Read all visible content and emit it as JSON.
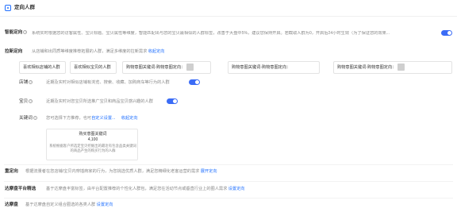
{
  "header": {
    "title": "定向人群"
  },
  "smart": {
    "label": "智能定向",
    "desc": "系统实时根据您的访客属性、宝贝标题、宝贝属性等维度，智能匹配出与您的宝贝最相似的人群标签，改善于大盘中5%，建议您保持开启。若截取人群为0，开启后24小时生效（为了保证您的效果...",
    "toggle_on": true
  },
  "keyword_targeting": {
    "label": "拉新定向",
    "desc": "从店铺和出同质等维度推荐拓展的人群，满足多维度的拉新需求",
    "link": "收起定向",
    "chips": [
      "喜欢相似店铺的人群",
      "喜欢相似宝贝的人群",
      "购物意图关键词-购物意图定向：",
      "购物意图关键词-购物意图定向：",
      "购物意图关键词-购物意图定向："
    ]
  },
  "shop": {
    "label": "店铺",
    "desc": "近期及实时对相似店铺有浏览、搜索、收藏、加购商车等行为的人群",
    "toggle_on": true
  },
  "item": {
    "label": "宝贝",
    "desc": "近期及实时对您宝贝所选推广宝贝和商品宝贝感兴趣的人群",
    "toggle_on": true
  },
  "keyword": {
    "label": "关键词",
    "desc": "您可选择下方推荐，也可",
    "link1": "自定义设置...",
    "link2": "收起定向"
  },
  "card": {
    "title": "购买意图关键词",
    "value": "4,100",
    "desc1": "系统根据客户所选定宝贝挖掘出的最近有包含品类关键词",
    "desc2": "的商品产生的购买行为的人群"
  },
  "retarget": {
    "label": "重定向",
    "desc": "根据流量者在您店铺/宝贝内穿插商家的行为，为您挑选优质人群，满足您精细化老客运营的需求",
    "link": "展开定向"
  },
  "platform": {
    "label": "达摩盘平台精选",
    "desc": "基于达摩盘丰富标签，由平台配置推荐的个性化人群包，满足您在活动节点或垂直行业上的圈人需求",
    "link": "设置定向"
  },
  "dmp": {
    "label": "达摩盘",
    "desc": "基于达摩盘自定义组合圈选的各类人群",
    "link": "设置定向"
  }
}
